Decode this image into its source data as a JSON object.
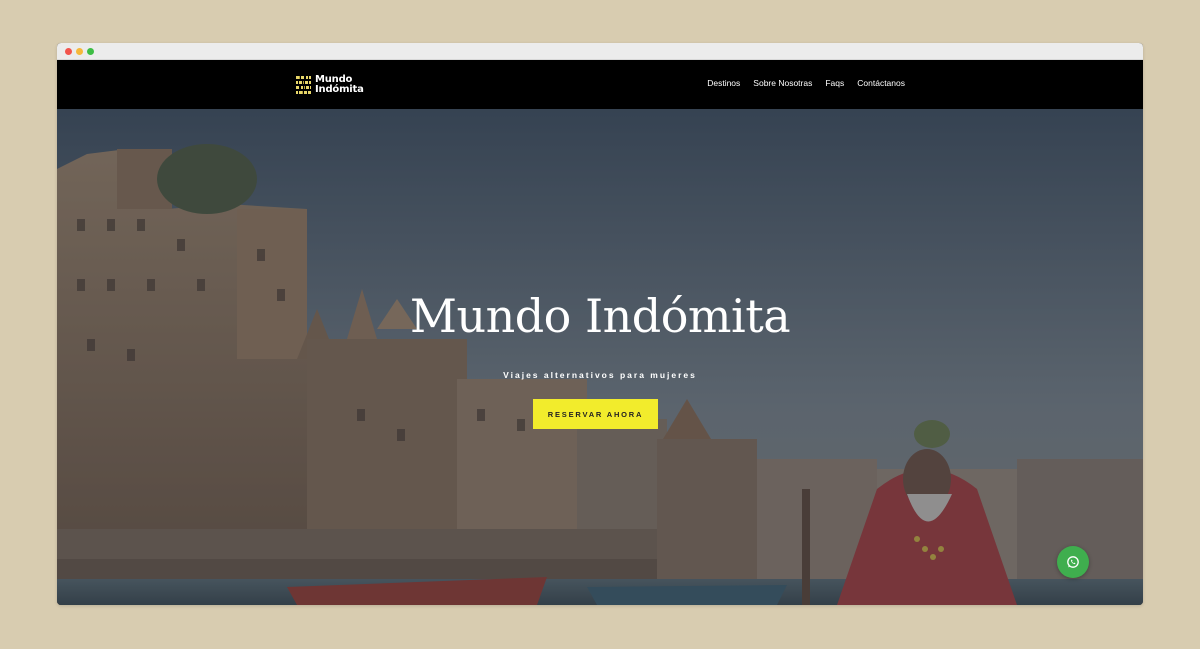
{
  "brand": {
    "line1": "Mundo",
    "line2": "Indómita"
  },
  "nav": {
    "items": [
      {
        "label": "Destinos"
      },
      {
        "label": "Sobre Nosotras"
      },
      {
        "label": "Faqs"
      },
      {
        "label": "Contáctanos"
      }
    ]
  },
  "hero": {
    "title": "Mundo Indómita",
    "subtitle": "Viajes alternativos para mujeres",
    "cta_label": "RESERVAR AHORA"
  },
  "colors": {
    "accent": "#f2ec2c",
    "navbar": "#000000",
    "whatsapp": "#3fae4e"
  },
  "icons": {
    "logo": "mundo-indomita-logo-icon",
    "chat": "whatsapp-icon"
  }
}
